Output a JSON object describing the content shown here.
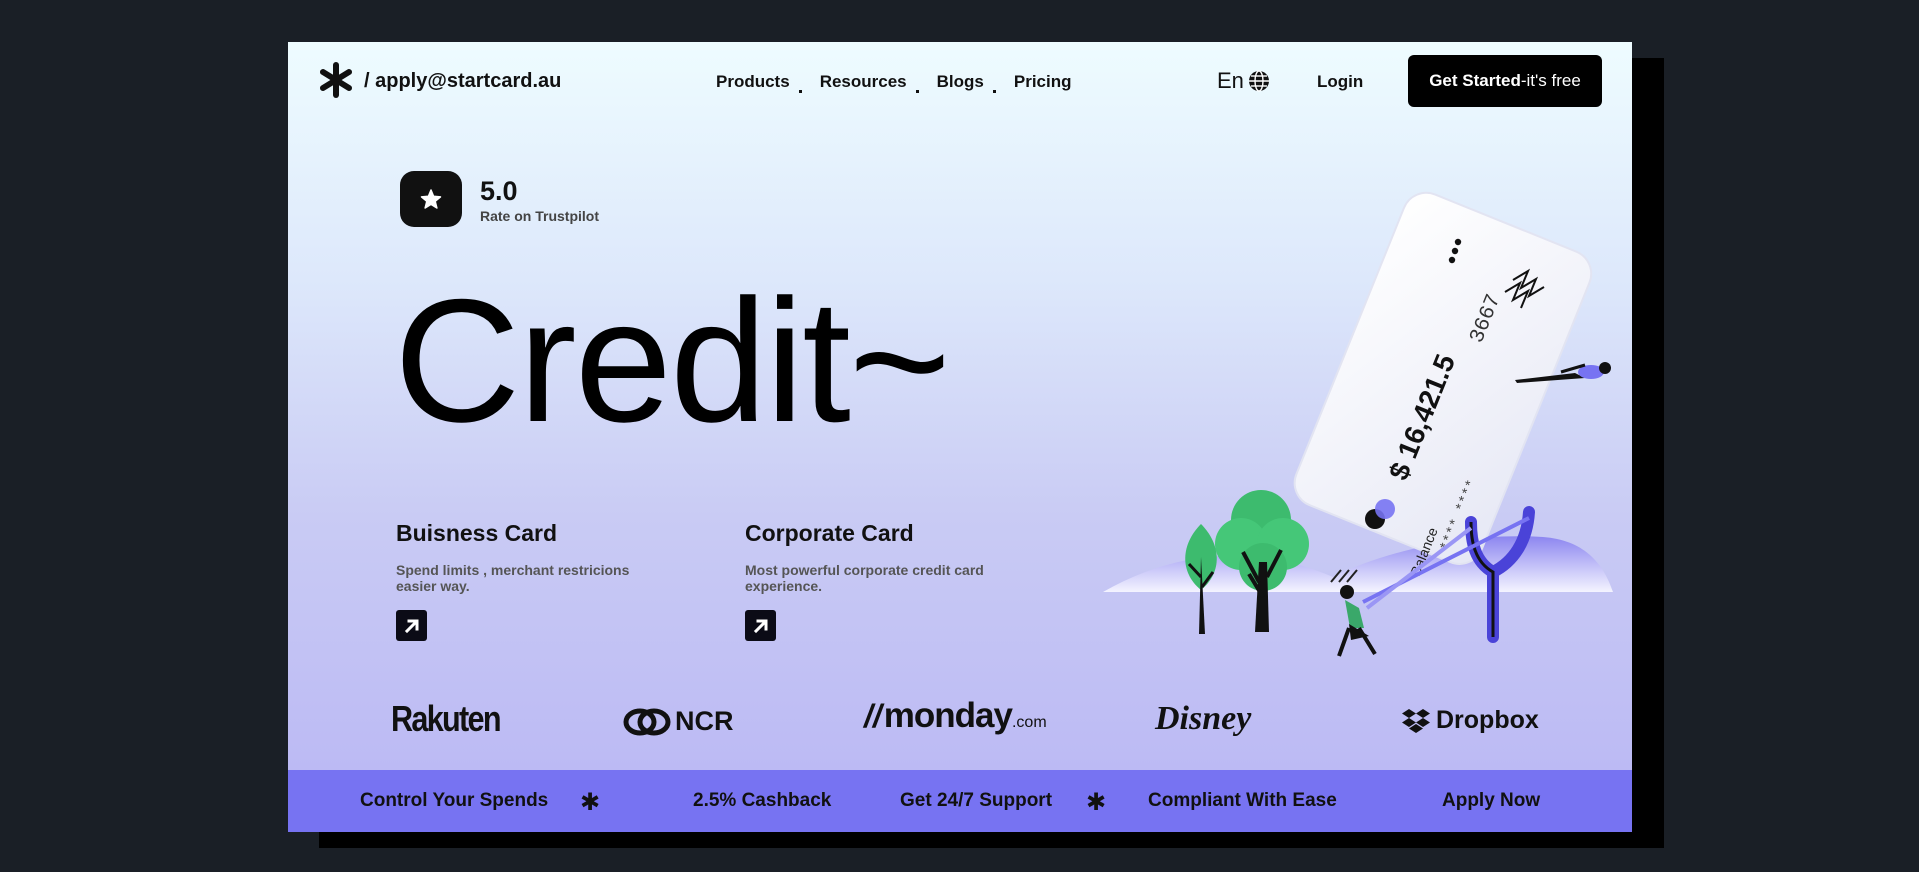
{
  "header": {
    "email": "/ apply@startcard.au",
    "nav": [
      "Products",
      "Resources",
      "Blogs",
      "Pricing"
    ],
    "language": "En",
    "login": "Login",
    "cta_bold": "Get Started",
    "cta_rest": "-it's free"
  },
  "rating": {
    "value": "5.0",
    "label": "Rate on Trustpilot"
  },
  "hero": {
    "title": "Credit~"
  },
  "cards": [
    {
      "title": "Buisness Card",
      "description": "Spend limits , merchant restricions easier way."
    },
    {
      "title": "Corporate Card",
      "description": "Most powerful corporate credit card experience."
    }
  ],
  "illustration": {
    "balance": "$ 16,421.5",
    "balance_label": "Balance",
    "card_digits": "3667",
    "masked": "**** ****"
  },
  "brands": [
    "Rakuten",
    "NCR",
    "monday",
    ".com",
    "Disney",
    "Dropbox"
  ],
  "bottom_bar": [
    "Control Your Spends",
    "2.5% Cashback",
    "Get 24/7 Support",
    "Compliant With Ease",
    "Apply Now"
  ],
  "colors": {
    "accent": "#7773f2",
    "dark": "#000000",
    "page_bg": "#1a1f26"
  }
}
